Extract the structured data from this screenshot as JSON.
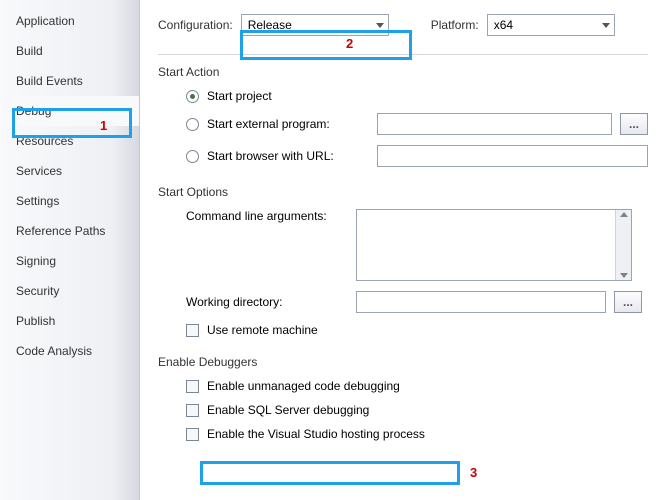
{
  "sidebar": {
    "items": [
      {
        "label": "Application"
      },
      {
        "label": "Build"
      },
      {
        "label": "Build Events"
      },
      {
        "label": "Debug"
      },
      {
        "label": "Resources"
      },
      {
        "label": "Services"
      },
      {
        "label": "Settings"
      },
      {
        "label": "Reference Paths"
      },
      {
        "label": "Signing"
      },
      {
        "label": "Security"
      },
      {
        "label": "Publish"
      },
      {
        "label": "Code Analysis"
      }
    ],
    "selected_index": 3
  },
  "top": {
    "config_label": "Configuration:",
    "config_value": "Release",
    "platform_label": "Platform:",
    "platform_value": "x64"
  },
  "start_action": {
    "title": "Start Action",
    "project": "Start project",
    "external": "Start external program:",
    "browser": "Start browser with URL:",
    "selected": "project",
    "browse": "..."
  },
  "start_options": {
    "title": "Start Options",
    "cmdline_label": "Command line arguments:",
    "workdir_label": "Working directory:",
    "remote_label": "Use remote machine",
    "remote_checked": false,
    "browse": "..."
  },
  "debuggers": {
    "title": "Enable Debuggers",
    "items": [
      {
        "label": "Enable unmanaged code debugging",
        "checked": false
      },
      {
        "label": "Enable SQL Server debugging",
        "checked": false
      },
      {
        "label": "Enable the Visual Studio hosting process",
        "checked": false
      }
    ]
  },
  "annotations": {
    "n1": "1",
    "n2": "2",
    "n3": "3"
  }
}
